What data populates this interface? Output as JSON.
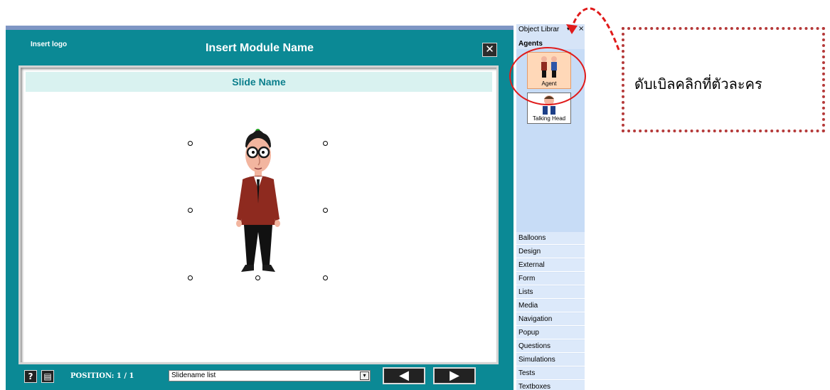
{
  "player": {
    "logo_text": "Insert logo",
    "module_title": "Insert Module Name",
    "close_glyph": "✕",
    "slide_title": "Slide Name",
    "help_glyph": "?",
    "notes_glyph": "▤",
    "position_label": "POSITION: 1 / 1",
    "slide_select_value": "Slidename list",
    "select_arrow_glyph": "▾",
    "prev_glyph": "◀",
    "next_glyph": "▶"
  },
  "library": {
    "title": "Object Librar",
    "dropdown_glyph": "▾",
    "close_glyph": "×",
    "section": "Agents",
    "items": [
      {
        "label": "Agent",
        "selected": true
      },
      {
        "label": "Talking Head",
        "selected": false
      }
    ],
    "categories": [
      "Balloons",
      "Design",
      "External",
      "Form",
      "Lists",
      "Media",
      "Navigation",
      "Popup",
      "Questions",
      "Simulations",
      "Tests",
      "Textboxes"
    ]
  },
  "callout": {
    "text": "ดับเบิลคลิกที่ตัวละคร"
  },
  "colors": {
    "player_teal": "#0b8995",
    "slide_header_bg": "#d9f2f0",
    "annotation_red": "#e01b1b",
    "callout_border": "#b53a3a",
    "library_bg": "#d6e4f7"
  },
  "icons": {
    "close": "close-icon",
    "help": "help-icon",
    "notes": "notes-icon",
    "prev": "prev-arrow-icon",
    "next": "next-arrow-icon"
  }
}
